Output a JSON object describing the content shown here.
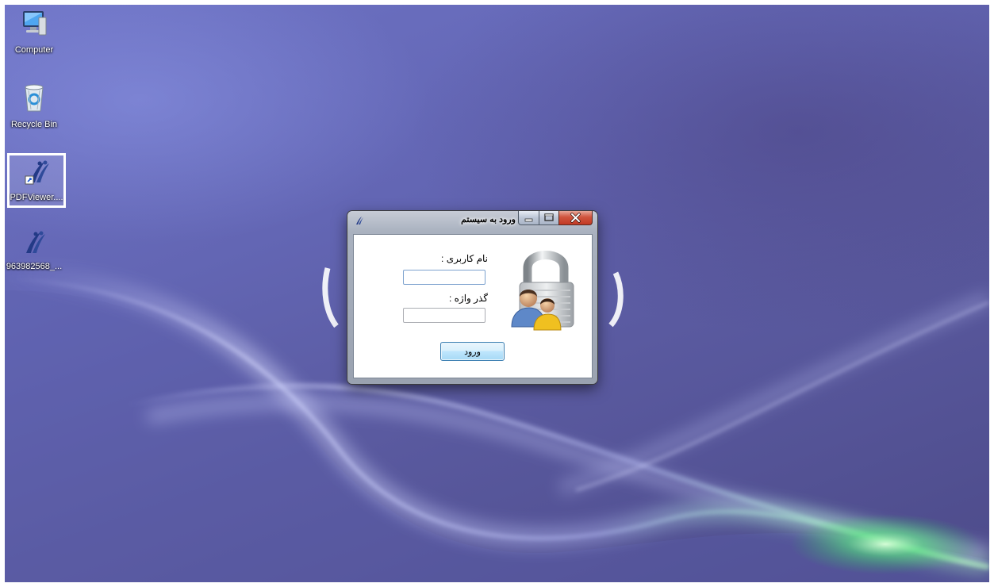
{
  "desktop": {
    "icons": [
      {
        "label": "Computer"
      },
      {
        "label": "Recycle Bin"
      },
      {
        "label": "PDFViewer...."
      },
      {
        "label": "963982568_..."
      }
    ]
  },
  "window": {
    "title": "ورود به سیستم",
    "username_label": "نام کاربری :",
    "username_value": "",
    "password_label": "گذر واژه :",
    "password_value": "",
    "login_label": "ورود",
    "caption_buttons": [
      "minimize",
      "maximize",
      "close"
    ]
  },
  "colors": {
    "wallpaper": "#6366b4",
    "close_button": "#c23a24",
    "login_button_border": "#3c7fb1"
  }
}
